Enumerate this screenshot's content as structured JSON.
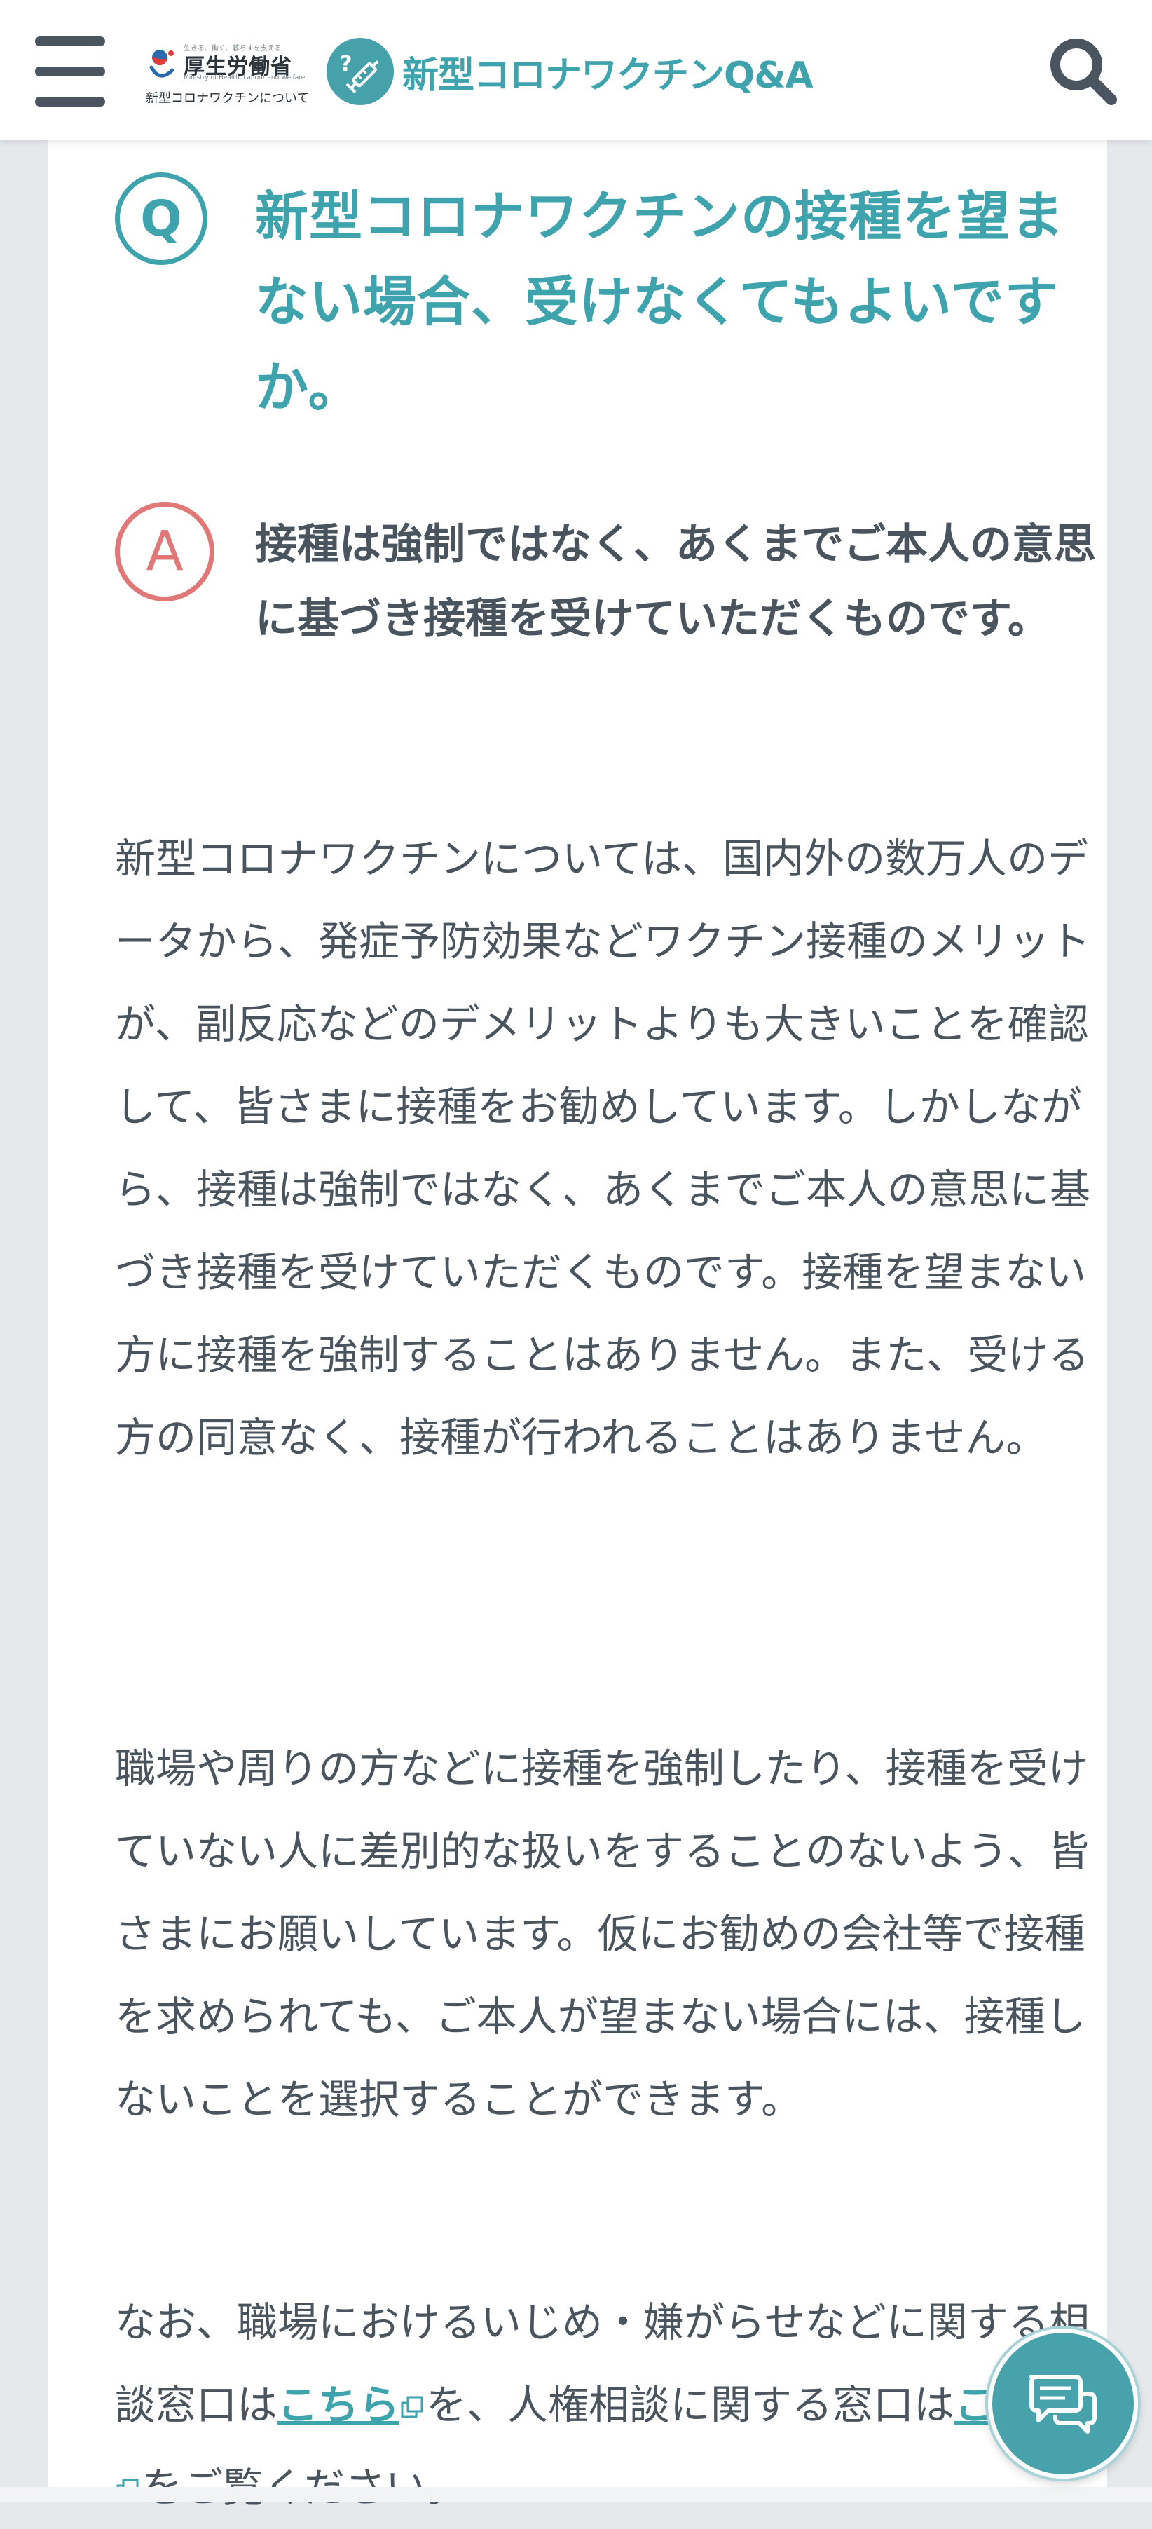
{
  "header": {
    "menu_icon": "hamburger-menu-icon",
    "mhlw": {
      "tagline": "生きる、働く、暮らすを支える",
      "name": "厚生労働省",
      "english": "Ministry of Health, Labour and Welfare",
      "subtitle": "新型コロナワクチンについて"
    },
    "site_title": "新型コロナワクチンQ&A",
    "search_icon": "search-icon"
  },
  "qa": {
    "question_badge": "Q",
    "question": "新型コロナワクチンの接種を望まない場合、受けなくてもよいですか。",
    "answer_badge": "A",
    "answer_summary": "接種は強制ではなく、あくまでご本人の意思に基づき接種を受けていただくものです。"
  },
  "body": {
    "paragraph1": "新型コロナワクチンについては、国内外の数万人のデータから、発症予防効果などワクチン接種のメリットが、副反応などのデメリットよりも大きいことを確認して、皆さまに接種をお勧めしています。しかしながら、接種は強制ではなく、あくまでご本人の意思に基づき接種を受けていただくものです。接種を望まない方に接種を強制することはありません。また、受ける方の同意なく、接種が行われることはありません。",
    "paragraph2": "職場や周りの方などに接種を強制したり、接種を受けていない人に差別的な扱いをすることのないよう、皆さまにお願いしています。仮にお勧めの会社等で接種を求められても、ご本人が望まない場合には、接種しないことを選択することができます。",
    "paragraph3": {
      "part1": "なお、職場におけるいじめ・嫌がらせなどに関する相談窓口は",
      "link1": "こちら",
      "part2": "を、人権相談に関する窓口は",
      "link2": "こちら",
      "part3": "をご覧ください。"
    }
  },
  "chat_icon": "chat-bubble-icon",
  "colors": {
    "accent": "#3fa3ad",
    "answer": "#e07878",
    "text": "#4a545e",
    "background": "#e6e9ec"
  }
}
